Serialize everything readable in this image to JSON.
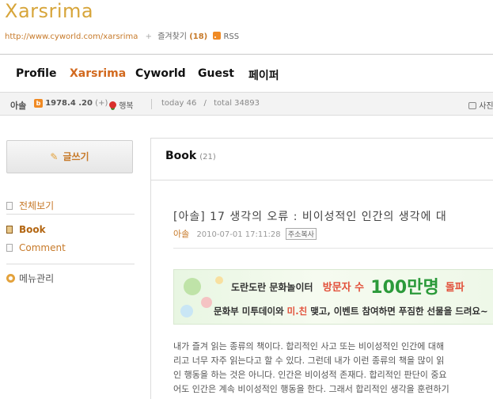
{
  "header": {
    "site_title": "Xarsrima",
    "url": "http://www.cyworld.com/xarsrima",
    "favorite_label": "즐겨찾기",
    "favorite_count": "(18)",
    "rss_label": "RSS"
  },
  "nav": {
    "items": [
      {
        "label": "Profile"
      },
      {
        "label": "Xarsrima"
      },
      {
        "label": "Cyworld"
      },
      {
        "label": "Guest"
      },
      {
        "label": "페이퍼"
      }
    ]
  },
  "infobar": {
    "name": "아솔",
    "birth": "1978.4 .20",
    "plus": "(+)",
    "mood": "행복",
    "today_label": "today",
    "today_value": "46",
    "slash": "/",
    "total_label": "total",
    "total_value": "34893",
    "photo_label": "사진"
  },
  "sidebar": {
    "write_label": "글쓰기",
    "items": [
      {
        "label": "전체보기"
      },
      {
        "label": "Book"
      },
      {
        "label": "Comment"
      }
    ],
    "manage_label": "메뉴관리"
  },
  "content": {
    "category_title": "Book",
    "category_count": "(21)",
    "post": {
      "title": "[아솔] 17 생각의 오류 : 비이성적인 인간의 생각에 대",
      "author": "아솔",
      "datetime": "2010-07-01 17:11:28",
      "copy_addr_label": "주소복사"
    },
    "banner": {
      "line1_prefix": "도란도란 문화놀이터",
      "line1_visitors": "방문자 수",
      "line1_big": "100만명",
      "line1_tail": "돌파",
      "line2_prefix": "문화부 미투데이와 ",
      "line2_highlight": "미.친",
      "line2_suffix": " 맺고, 이벤트 참여하면 푸짐한 선물을 드려요~"
    },
    "body_lines": [
      "내가 즐겨 읽는 종류의 책이다. 합리적인 사고 또는 비이성적인 인간에 대해",
      "리고 너무 자주 읽는다고 할 수 있다. 그런데 내가 이런 종류의 책을 많이 읽",
      "인 행동을 하는 것은 아니다. 인간은 비이성적 존재다. 합리적인 판단이 중요",
      "어도 인간은 계속 비이성적인 행동을 한다. 그래서 합리적인 생각을 훈련하기"
    ]
  },
  "colors": {
    "accent": "#c77a2a",
    "title_gold": "#d7a53a",
    "active_nav": "#d2691e",
    "banner_green": "#2b9a3a"
  }
}
